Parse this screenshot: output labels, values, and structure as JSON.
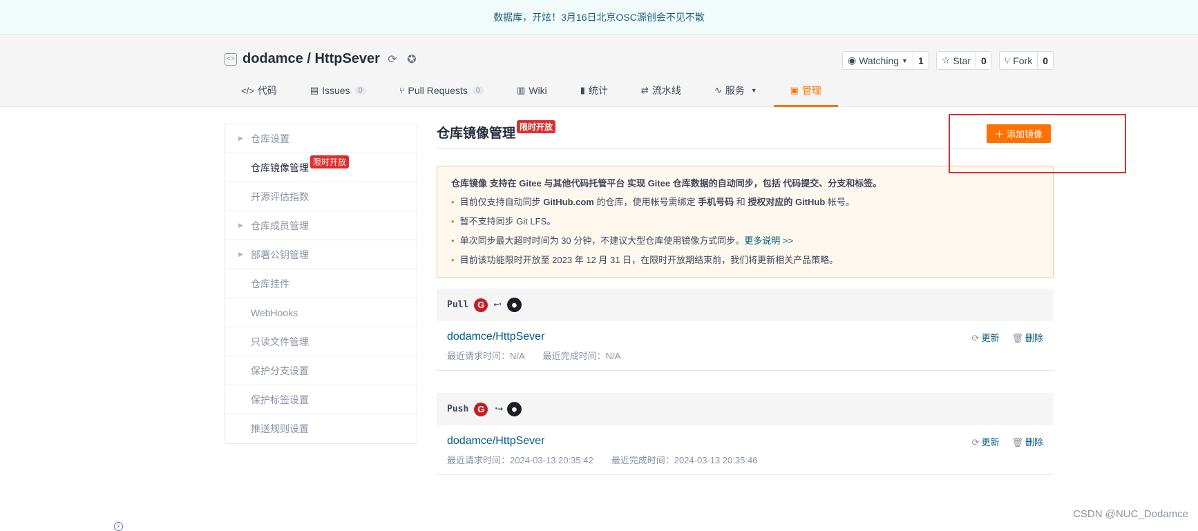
{
  "banner": {
    "text": "数据库，开炫！3月16日北京OSC源创会不见不散"
  },
  "repo": {
    "owner": "dodamce",
    "separator": " / ",
    "name": "HttpSever",
    "full_title": "dodamce / HttpSever"
  },
  "actions": {
    "watch": {
      "label": "Watching",
      "count": "1"
    },
    "star": {
      "label": "Star",
      "count": "0"
    },
    "fork": {
      "label": "Fork",
      "count": "0"
    }
  },
  "tabs": [
    {
      "label": "代码",
      "icon": "code-icon"
    },
    {
      "label": "Issues",
      "badge": "0",
      "icon": "issues-icon"
    },
    {
      "label": "Pull Requests",
      "badge": "0",
      "icon": "pull-request-icon"
    },
    {
      "label": "Wiki",
      "icon": "wiki-icon"
    },
    {
      "label": "统计",
      "icon": "stats-icon"
    },
    {
      "label": "流水线",
      "icon": "pipeline-icon"
    },
    {
      "label": "服务",
      "icon": "service-icon"
    },
    {
      "label": "管理",
      "icon": "manage-icon",
      "active": true
    }
  ],
  "sidebar": {
    "items": [
      {
        "label": "仓库设置",
        "caret": true
      },
      {
        "label": "仓库镜像管理",
        "active": true,
        "badge": "限时开放"
      },
      {
        "label": "开源评估指数"
      },
      {
        "label": "仓库成员管理",
        "caret": true
      },
      {
        "label": "部署公钥管理",
        "caret": true
      },
      {
        "label": "仓库挂件"
      },
      {
        "label": "WebHooks"
      },
      {
        "label": "只读文件管理"
      },
      {
        "label": "保护分支设置"
      },
      {
        "label": "保护标签设置"
      },
      {
        "label": "推送规则设置"
      }
    ]
  },
  "main": {
    "title": "仓库镜像管理",
    "title_badge": "限时开放",
    "add_button": "添加镜像",
    "notice": {
      "head": "仓库镜像 支持在 Gitee 与其他代码托管平台 实现 Gitee 仓库数据的自动同步，包括 代码提交、分支和标签。",
      "line1_a": "目前仅支持自动同步 ",
      "line1_b": "GitHub.com",
      "line1_c": " 的仓库，使用帐号需绑定 ",
      "line1_d": "手机号码",
      "line1_e": " 和 ",
      "line1_f": "授权对应的 GitHub",
      "line1_g": " 帐号。",
      "line2": "暂不支持同步 Git LFS。",
      "line3_a": "单次同步最大超时时间为 30 分钟，不建议大型仓库使用镜像方式同步。",
      "line3_link": "更多说明 >>",
      "line4": "目前该功能限时开放至 2023 年 12 月 31 日，在限时开放期结束前，我们将更新相关产品策略。"
    },
    "pull": {
      "label": "Pull",
      "arrow": "←·",
      "repo": "dodamce/HttpSever",
      "last_request": "最近请求时间：N/A",
      "last_complete": "最近完成时间：N/A",
      "update": "更新",
      "delete": "删除"
    },
    "push": {
      "label": "Push",
      "arrow": "·→",
      "repo": "dodamce/HttpSever",
      "last_request": "最近请求时间：2024-03-13 20:35:42",
      "last_complete": "最近完成时间：2024-03-13 20:35:46",
      "update": "更新",
      "delete": "删除"
    }
  },
  "watermark": "CSDN @NUC_Dodamce",
  "colors": {
    "accent": "#fe7300",
    "link": "#005980",
    "badge": "#e02d2d",
    "highlight_box": "#e02d2d"
  }
}
